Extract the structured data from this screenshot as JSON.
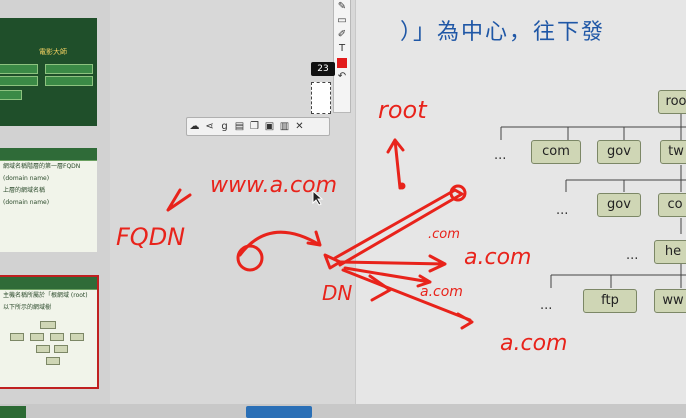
{
  "slide": {
    "heading_line": "）」為中心，往下發"
  },
  "tree": {
    "nodes": [
      {
        "label": "roo"
      },
      {
        "label": "com"
      },
      {
        "label": "gov"
      },
      {
        "label": "tw"
      },
      {
        "label": "gov"
      },
      {
        "label": "co"
      },
      {
        "label": "he"
      },
      {
        "label": "ftp"
      },
      {
        "label": "ww"
      }
    ],
    "ellipsis": "..."
  },
  "annotations": {
    "root": "root",
    "www": "www.a.com",
    "fqdn": "FQDN",
    "dn": "DN",
    "com1": ".com",
    "com2": "a.com",
    "com3": "a.com",
    "com4": "a.com"
  },
  "toolbar": {
    "size_badge": "23",
    "tools": [
      "pen-icon",
      "rectangle-icon",
      "highlighter-icon",
      "text-icon",
      "color-swatch",
      "undo-icon"
    ],
    "text_tool": "T",
    "accent_color": "#e21b1b"
  },
  "float_toolbar": {
    "icons": [
      "cloud-icon",
      "share-icon",
      "google-icon",
      "print-icon",
      "copy-icon",
      "save-icon",
      "close-icon"
    ],
    "close": "✕",
    "google": "g"
  },
  "thumbnails": {
    "thumb1_title": "電影大師",
    "thumb2_text": [
      "網域名稱階層的第一層FQDN",
      "(domain name)",
      "上層的網域名稱",
      "(domain name)"
    ],
    "thumb3_text": [
      "主機名稱所屬於「根網域 (root)",
      "以下所示的網域樹"
    ]
  }
}
